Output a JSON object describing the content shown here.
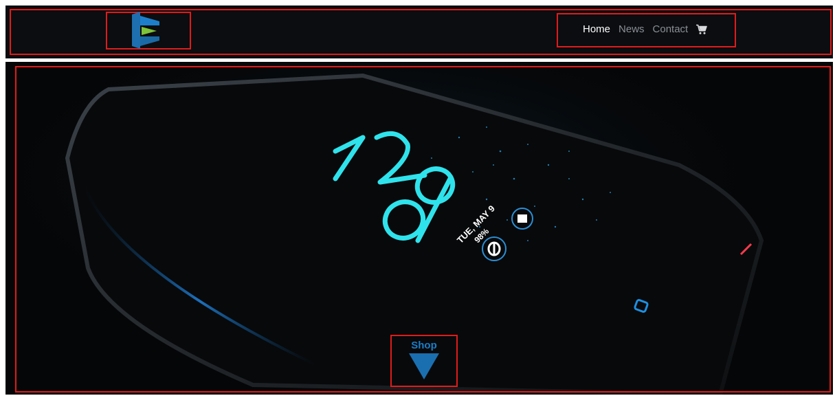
{
  "header": {
    "logo_name": "brand-logo",
    "nav": [
      {
        "label": "Home",
        "active": true
      },
      {
        "label": "News",
        "active": false
      },
      {
        "label": "Contact",
        "active": false
      }
    ],
    "cart_icon": "shopping-cart-icon"
  },
  "hero": {
    "phone_screen": {
      "time_hour": "12",
      "time_minute": "09",
      "date": "TUE, MAY 9",
      "battery": "98%"
    },
    "cta": {
      "label": "Shop",
      "icon": "down-triangle-icon"
    }
  },
  "colors": {
    "outline": "#e11b1b",
    "accent_blue": "#1a7ec8",
    "clock_cyan": "#2fe3ec",
    "nav_active": "#ffffff",
    "nav_inactive": "#8b8f96",
    "background_dark": "#050607"
  }
}
